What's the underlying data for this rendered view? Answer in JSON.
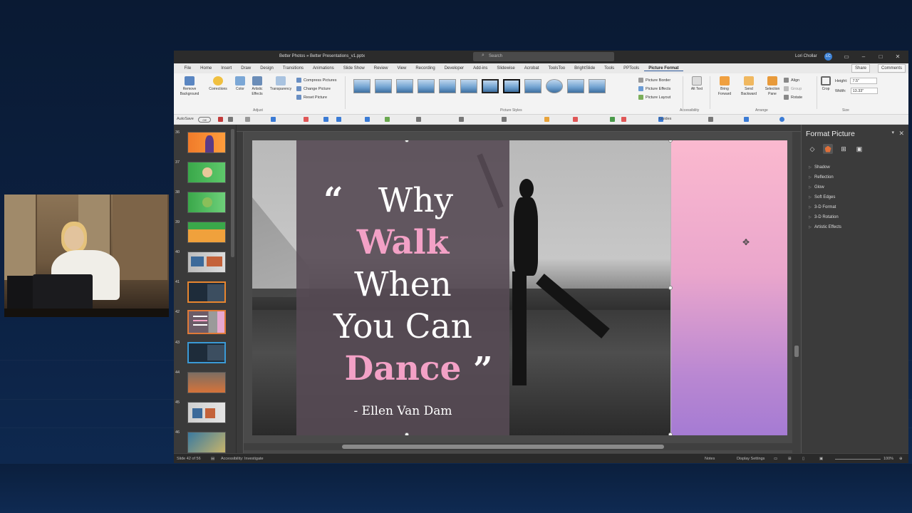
{
  "window": {
    "doc_title": "Better Photos » Better Presentations_v1.pptx",
    "search_placeholder": "Search",
    "user_name": "Lori Chollar",
    "user_initials": "LC"
  },
  "menu": {
    "tabs": [
      "File",
      "Home",
      "Insert",
      "Draw",
      "Design",
      "Transitions",
      "Animations",
      "Slide Show",
      "Review",
      "View",
      "Recording",
      "Developer",
      "Add-ins",
      "Slidewise",
      "Acrobat",
      "ToolsToo",
      "BrightSlide",
      "Tools",
      "PPTools",
      "Picture Format"
    ],
    "active_tab": "Picture Format",
    "share_label": "Share",
    "comments_label": "Comments"
  },
  "ribbon": {
    "remove_background": "Remove Background",
    "corrections": "Corrections",
    "color": "Color",
    "artistic_effects": "Artistic Effects",
    "transparency": "Transparency",
    "compress_pictures": "Compress Pictures",
    "change_picture": "Change Picture",
    "reset_picture": "Reset Picture",
    "adjust_group": "Adjust",
    "picture_styles_group": "Picture Styles",
    "picture_border": "Picture Border",
    "picture_effects": "Picture Effects",
    "picture_layout": "Picture Layout",
    "alt_text": "Alt Text",
    "accessibility_group": "Accessibility",
    "bring_forward": "Bring Forward",
    "send_backward": "Send Backward",
    "selection_pane": "Selection Pane",
    "align": "Align",
    "group": "Group",
    "rotate": "Rotate",
    "arrange_group": "Arrange",
    "crop": "Crop",
    "height_label": "Height:",
    "height_value": "7.5\"",
    "width_label": "Width:",
    "width_value": "13.33\"",
    "size_group": "Size"
  },
  "qat": {
    "autosave_label": "AutoSave",
    "autosave_state": "Off",
    "guides_label": "Guides"
  },
  "thumbnails": {
    "numbers": [
      "36",
      "37",
      "38",
      "39",
      "40",
      "41",
      "42",
      "43",
      "44",
      "45",
      "46"
    ]
  },
  "slide": {
    "line1": "Why",
    "line2": "Walk",
    "line3": "When",
    "line4": "You Can",
    "line5": "Dance",
    "open_quote": "“",
    "close_quote": "”",
    "author": "- Ellen Van Dam"
  },
  "format_pane": {
    "title": "Format Picture",
    "items": [
      "Shadow",
      "Reflection",
      "Glow",
      "Soft Edges",
      "3-D Format",
      "3-D Rotation",
      "Artistic Effects"
    ]
  },
  "status": {
    "slide_info": "Slide 42 of 56",
    "accessibility": "Accessibility: Investigate",
    "notes": "Notes",
    "display_settings": "Display Settings",
    "zoom": "100%"
  },
  "colors": {
    "accent_pink": "#f3a1c6",
    "text_panel": "#564a54",
    "gradient_top": "#fbb9cf",
    "gradient_bottom": "#a57bd3",
    "selected_thumb_border": "#e07a38"
  }
}
